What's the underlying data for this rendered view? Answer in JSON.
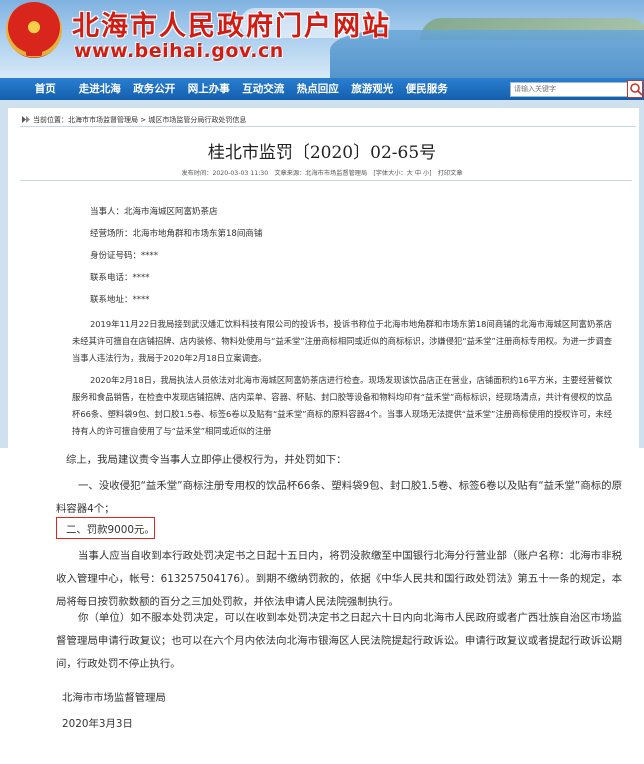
{
  "header": {
    "site_title": "北海市人民政府门户网站",
    "site_url": "www.beihai.gov.cn"
  },
  "nav": {
    "items": [
      "首页",
      "走进北海",
      "政务公开",
      "网上办事",
      "互动交流",
      "热点回应",
      "旅游观光",
      "便民服务"
    ],
    "search_placeholder": "请输入关键字"
  },
  "breadcrumb": {
    "label": "当前位置：",
    "path": "北海市市场监督管理局 > 城区市场监管分局行政处罚信息"
  },
  "document": {
    "title": "桂北市监罚〔2020〕02-65号",
    "meta": "发布时间：2020-03-03 11:30　文章来源：北海市市场监督管理局　[字体大小：大 中 小]　打印文章",
    "party": "当事人：北海市海城区阿富奶茶店",
    "address": "经营场所：北海市地角群和市场东第18间商铺",
    "id_number": "身份证号码：****",
    "phone": "联系电话：****",
    "contact_address": "联系地址：****",
    "para1": "2019年11月22日我局接到武汉燔汇饮料科技有限公司的投诉书，投诉书称位于北海市地角群和市场东第18间商铺的北海市海城区阿富奶茶店未经其许可擅自在店铺招牌、店内装修、物料处使用与“益禾堂”注册商标相同或近似的商标标识，涉嫌侵犯“益禾堂”注册商标专用权。为进一步调查当事人违法行为，我局于2020年2月18日立案调查。",
    "para2": "2020年2月18日，我局执法人员依法对北海市海城区阿富奶茶店进行检查。现场发现该饮品店正在营业，店铺面积约16平方米，主要经营餐饮服务和食品销售，在检查中发现店铺招牌、店内菜单、容器、杯贴、封口胶等设备和物料均印有“益禾堂”商标标识，经现场清点，共计有侵权的饮品杯66条、塑料袋9包、封口胶1.5卷、标签6卷以及贴有“益禾堂”商标的原料容器4个。当事人现场无法提供“益禾堂”注册商标使用的授权许可，未经持有人的许可擅自使用了与“益禾堂”相同或近似的注册",
    "para3": "综上，我局建议责令当事人立即停止侵权行为，并处罚如下：",
    "para4": "一、没收侵犯“益禾堂”商标注册专用权的饮品杯66条、塑料袋9包、封口胶1.5卷、标签6卷以及贴有“益禾堂”商标的原料容器4个；",
    "para5": "二、罚款9000元。",
    "para6": "当事人应当自收到本行政处罚决定书之日起十五日内，将罚没款缴至中国银行北海分行营业部（账户名称：北海市非税收入管理中心，帐号：613257504176）。到期不缴纳罚款的，依据《中华人民共和国行政处罚法》第五十一条的规定，本局将每日按罚款数额的百分之三加处罚款，并依法申请人民法院强制执行。",
    "para7": "你（单位）如不服本处罚决定，可以在收到本处罚决定书之日起六十日内向北海市人民政府或者广西壮族自治区市场监督管理局申请行政复议；也可以在六个月内依法向北海市银海区人民法院提起行政诉讼。申请行政复议或者提起行政诉讼期间，行政处罚不停止执行。",
    "signature": "北海市市场监督管理局",
    "date": "2020年3月3日"
  },
  "colors": {
    "nav_blue": "#1a6cc0",
    "title_red": "#d01c12",
    "highlight_red": "#e0261c"
  }
}
